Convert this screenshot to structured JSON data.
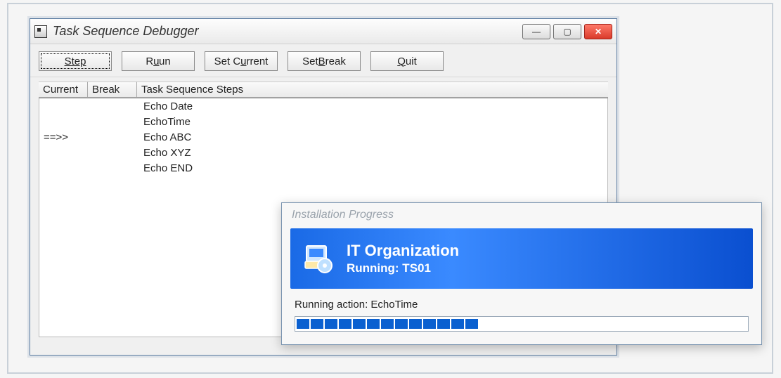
{
  "debugger": {
    "title": "Task Sequence Debugger",
    "buttons": {
      "step": "Step",
      "run_prefix": "R",
      "run_suffix": "un",
      "setcurrent_prefix": "Set C",
      "setcurrent_suffix": "urrent",
      "setbreak_prefix": "Set ",
      "setbreak_suffix": "reak",
      "setbreak_ul": "B",
      "run_ul": "u",
      "setcurrent_ul": "u",
      "quit_ul": "Q",
      "quit_suffix": "uit"
    },
    "columns": {
      "current": "Current",
      "break": "Break",
      "tss": "Task Sequence Steps"
    },
    "rows": [
      {
        "current": "",
        "break": "",
        "tss": "Echo Date"
      },
      {
        "current": "",
        "break": "",
        "tss": "EchoTime"
      },
      {
        "current": "==>>",
        "break": "",
        "tss": "Echo ABC"
      },
      {
        "current": "",
        "break": "",
        "tss": "Echo XYZ"
      },
      {
        "current": "",
        "break": "",
        "tss": "Echo END"
      }
    ]
  },
  "progress": {
    "title": "Installation Progress",
    "org": "IT Organization",
    "running": "Running: TS01",
    "action": "Running action: EchoTime",
    "segments": 13
  }
}
